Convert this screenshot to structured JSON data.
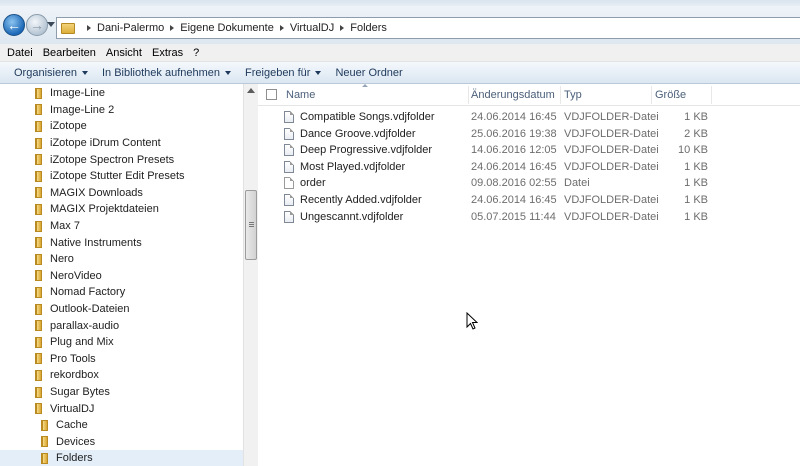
{
  "window": {
    "breadcrumbs": [
      "Dani-Palermo",
      "Eigene Dokumente",
      "VirtualDJ",
      "Folders"
    ]
  },
  "menu": [
    "Datei",
    "Bearbeiten",
    "Ansicht",
    "Extras",
    "?"
  ],
  "commands": [
    {
      "label": "Organisieren",
      "dropdown": true
    },
    {
      "label": "In Bibliothek aufnehmen",
      "dropdown": true
    },
    {
      "label": "Freigeben für",
      "dropdown": true
    },
    {
      "label": "Neuer Ordner",
      "dropdown": false
    }
  ],
  "nav": {
    "items": [
      {
        "label": "Image-Line",
        "level": 1
      },
      {
        "label": "Image-Line 2",
        "level": 1
      },
      {
        "label": "iZotope",
        "level": 1
      },
      {
        "label": "iZotope iDrum Content",
        "level": 1
      },
      {
        "label": "iZotope Spectron Presets",
        "level": 1
      },
      {
        "label": "iZotope Stutter Edit Presets",
        "level": 1
      },
      {
        "label": "MAGIX Downloads",
        "level": 1
      },
      {
        "label": "MAGIX Projektdateien",
        "level": 1
      },
      {
        "label": "Max 7",
        "level": 1
      },
      {
        "label": "Native Instruments",
        "level": 1
      },
      {
        "label": "Nero",
        "level": 1
      },
      {
        "label": "NeroVideo",
        "level": 1
      },
      {
        "label": "Nomad Factory",
        "level": 1
      },
      {
        "label": "Outlook-Dateien",
        "level": 1
      },
      {
        "label": "parallax-audio",
        "level": 1
      },
      {
        "label": "Plug and Mix",
        "level": 1
      },
      {
        "label": "Pro Tools",
        "level": 1
      },
      {
        "label": "rekordbox",
        "level": 1
      },
      {
        "label": "Sugar Bytes",
        "level": 1
      },
      {
        "label": "VirtualDJ",
        "level": 1
      },
      {
        "label": "Cache",
        "level": 2
      },
      {
        "label": "Devices",
        "level": 2
      },
      {
        "label": "Folders",
        "level": 2,
        "selected": true
      }
    ]
  },
  "columns": {
    "name": "Name",
    "date": "Änderungsdatum",
    "type": "Typ",
    "size": "Größe"
  },
  "files": [
    {
      "name": "Compatible Songs.vdjfolder",
      "date": "24.06.2014 16:45",
      "type": "VDJFOLDER-Datei",
      "size": "1 KB",
      "icon": "vdjfolder-file-icon"
    },
    {
      "name": "Dance Groove.vdjfolder",
      "date": "25.06.2016 19:38",
      "type": "VDJFOLDER-Datei",
      "size": "2 KB",
      "icon": "vdjfolder-file-icon"
    },
    {
      "name": "Deep Progressive.vdjfolder",
      "date": "14.06.2016 12:05",
      "type": "VDJFOLDER-Datei",
      "size": "10 KB",
      "icon": "vdjfolder-file-icon"
    },
    {
      "name": "Most Played.vdjfolder",
      "date": "24.06.2014 16:45",
      "type": "VDJFOLDER-Datei",
      "size": "1 KB",
      "icon": "vdjfolder-file-icon"
    },
    {
      "name": "order",
      "date": "09.08.2016 02:55",
      "type": "Datei",
      "size": "1 KB",
      "icon": "blank-file-icon"
    },
    {
      "name": "Recently Added.vdjfolder",
      "date": "24.06.2014 16:45",
      "type": "VDJFOLDER-Datei",
      "size": "1 KB",
      "icon": "vdjfolder-file-icon"
    },
    {
      "name": "Ungescannt.vdjfolder",
      "date": "05.07.2015 11:44",
      "type": "VDJFOLDER-Datei",
      "size": "1 KB",
      "icon": "vdjfolder-file-icon"
    }
  ]
}
